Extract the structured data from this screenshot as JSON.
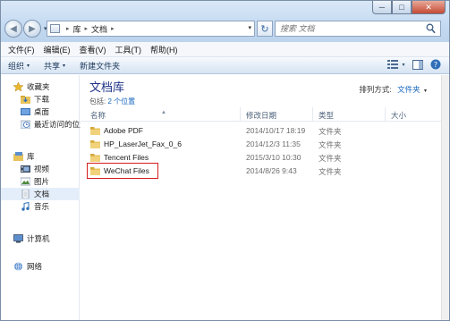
{
  "window": {
    "caption": {
      "minimize": "─",
      "maximize": "□",
      "close": "✕"
    }
  },
  "nav": {
    "back": "◀",
    "forward": "▶",
    "history_drop": "▾"
  },
  "address": {
    "crumbs": [
      "库",
      "文档"
    ],
    "separator": "▸",
    "drop": "▾"
  },
  "refresh_glyph": "↻",
  "search": {
    "placeholder": "搜索 文档"
  },
  "menu": [
    "文件(F)",
    "编辑(E)",
    "查看(V)",
    "工具(T)",
    "帮助(H)"
  ],
  "commands": {
    "organize": "组织",
    "share": "共享",
    "new_folder": "新建文件夹",
    "drop": "▾"
  },
  "sidebar": {
    "favorites": {
      "label": "收藏夹",
      "items": [
        "下载",
        "桌面",
        "最近访问的位置"
      ]
    },
    "libraries": {
      "label": "库",
      "items": [
        "视频",
        "图片",
        "文档",
        "音乐"
      ]
    },
    "computer": {
      "label": "计算机"
    },
    "network": {
      "label": "网络"
    }
  },
  "library": {
    "title": "文档库",
    "includes_prefix": "包括:",
    "includes_link": "2 个位置",
    "arrange_label": "排列方式:",
    "arrange_value": "文件夹",
    "arrange_drop": "▾"
  },
  "columns": {
    "name": "名称",
    "modified": "修改日期",
    "type": "类型",
    "size": "大小",
    "sort_caret": "▲"
  },
  "files": [
    {
      "name": "Adobe PDF",
      "modified": "2014/10/17 18:19",
      "type": "文件夹",
      "size": ""
    },
    {
      "name": "HP_LaserJet_Fax_0_6",
      "modified": "2014/12/3 11:35",
      "type": "文件夹",
      "size": ""
    },
    {
      "name": "Tencent Files",
      "modified": "2015/3/10 10:30",
      "type": "文件夹",
      "size": ""
    },
    {
      "name": "WeChat Files",
      "modified": "2014/8/26 9:43",
      "type": "文件夹",
      "size": ""
    }
  ],
  "colors": {
    "accent": "#1e3287",
    "link": "#1565c0",
    "highlight": "#d51d1d",
    "folder": "#e8c25a"
  }
}
